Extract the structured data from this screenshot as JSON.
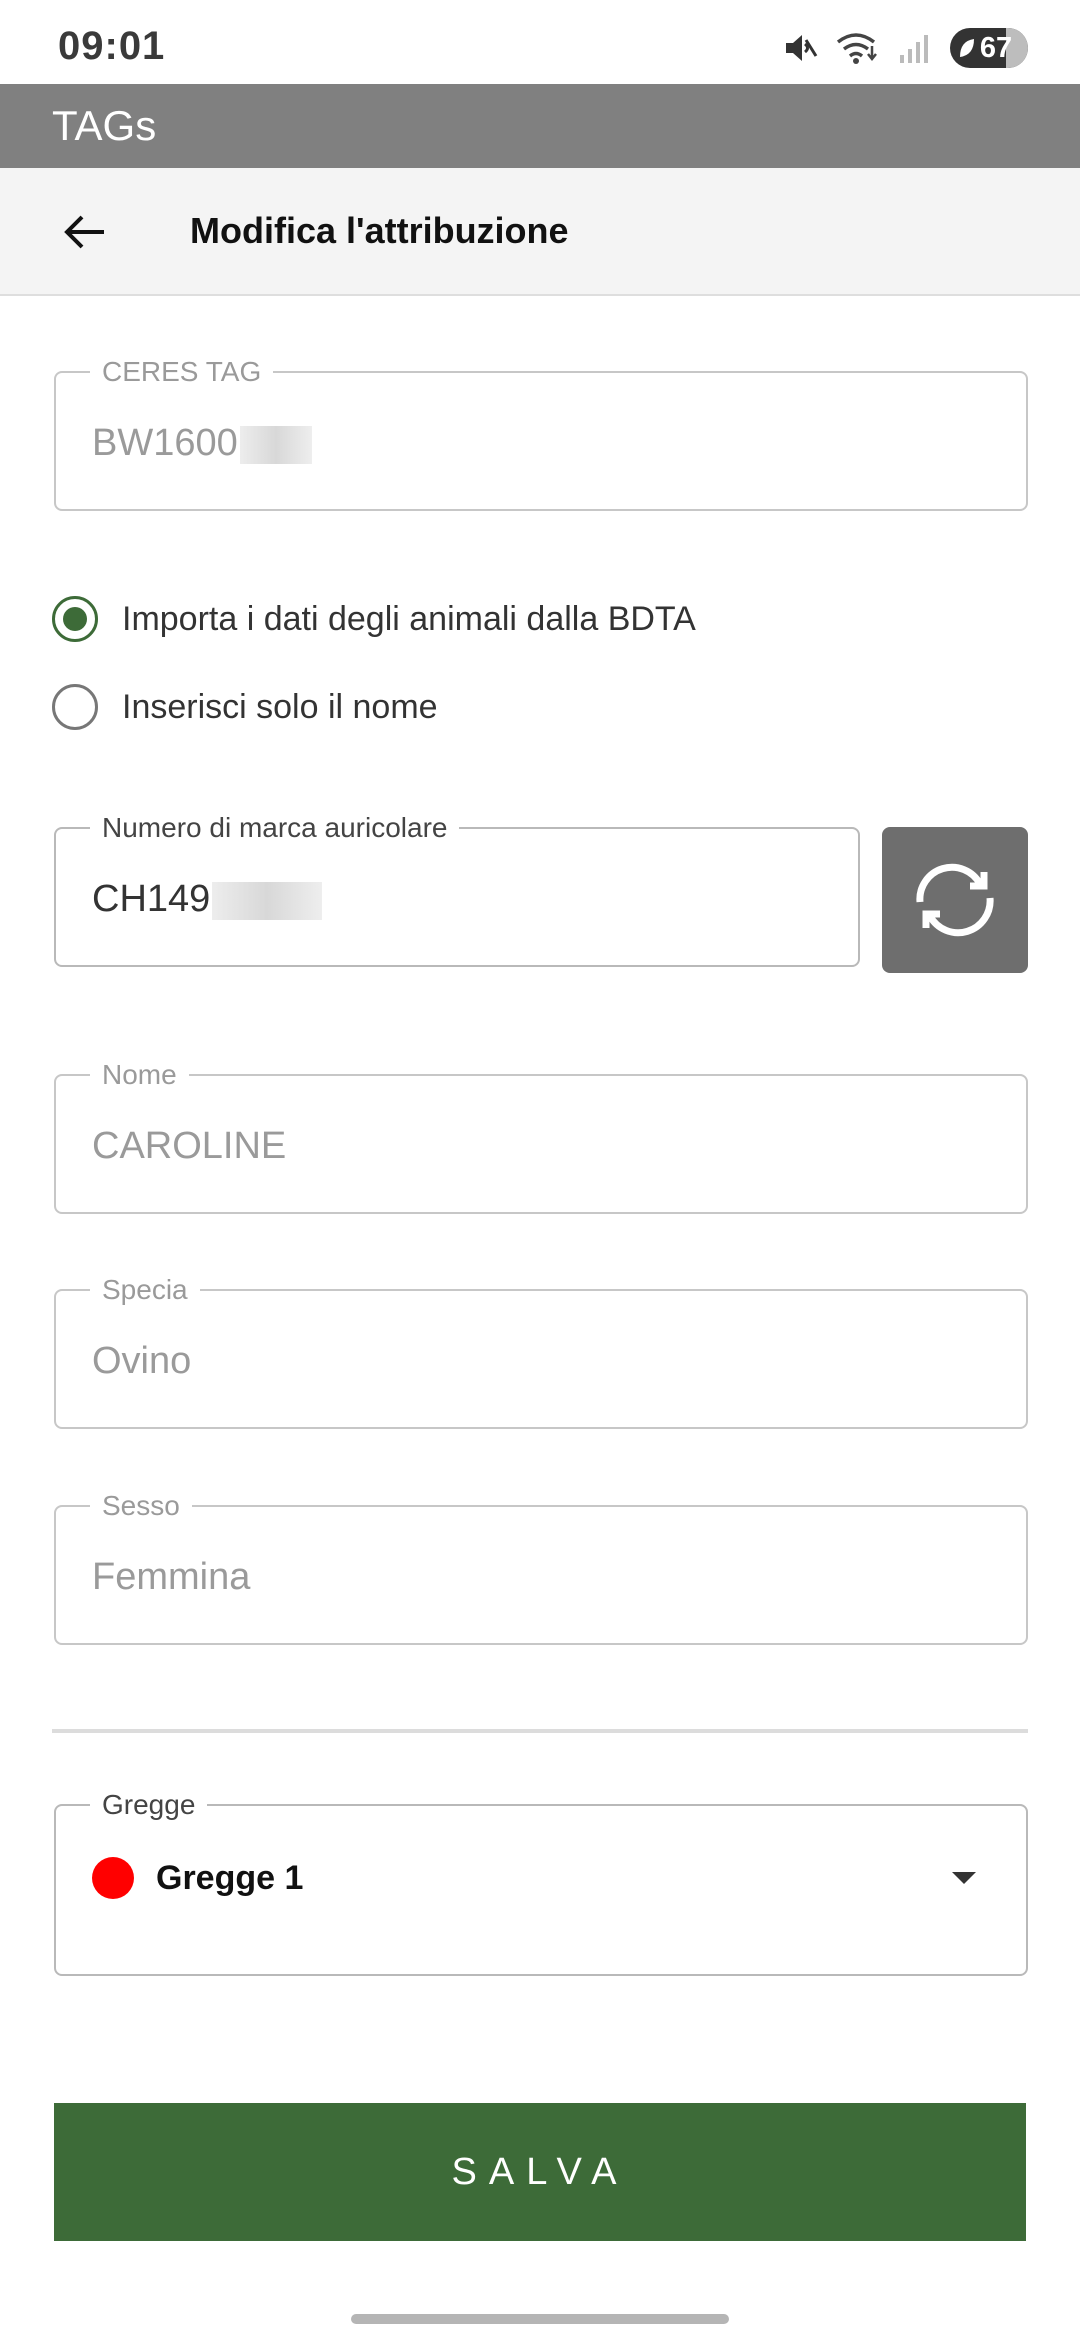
{
  "status_bar": {
    "time": "09:01",
    "battery": "67",
    "icons": [
      "mute-icon",
      "wifi-icon",
      "signal-icon",
      "battery-icon"
    ]
  },
  "app_bar": {
    "title": "TAGs"
  },
  "header": {
    "back_icon": "arrow-left-icon",
    "title": "Modifica l'attribuzione"
  },
  "form": {
    "ceres_tag": {
      "label": "CERES TAG",
      "value": "BW1600"
    },
    "options": [
      {
        "label": "Importa i dati degli animali dalla BDTA",
        "selected": true
      },
      {
        "label": "Inserisci solo il nome",
        "selected": false
      }
    ],
    "ear_tag": {
      "label": "Numero di marca auricolare",
      "value": "CH149",
      "refresh_icon": "refresh-icon"
    },
    "nome": {
      "label": "Nome",
      "value": "CAROLINE"
    },
    "specia": {
      "label": "Specia",
      "value": "Ovino"
    },
    "sesso": {
      "label": "Sesso",
      "value": "Femmina"
    },
    "gregge": {
      "label": "Gregge",
      "value": "Gregge 1",
      "color": "#ff0000"
    }
  },
  "save_button": {
    "label": "SALVA"
  },
  "colors": {
    "primary": "#3d6b38",
    "app_bar": "#808080",
    "refresh_button": "#6e6e6e"
  }
}
